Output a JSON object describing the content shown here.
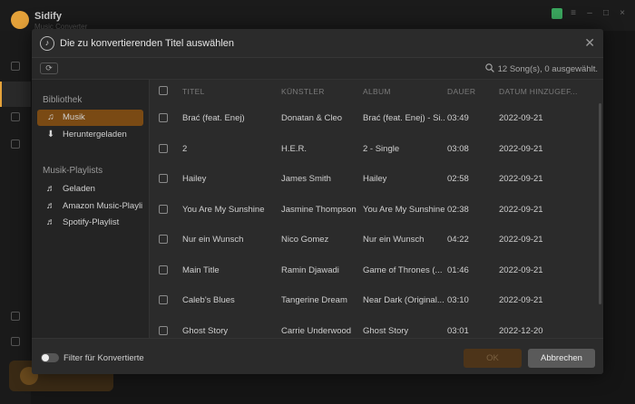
{
  "app": {
    "name": "Sidify",
    "subname": "Music Converter"
  },
  "dialog": {
    "title": "Die zu konvertierenden Titel auswählen",
    "close_icon": "close-icon",
    "song_count": "12 Song(s), 0 ausgewählt.",
    "sidebar": {
      "library_heading": "Bibliothek",
      "library_items": [
        {
          "label": "Musik",
          "icon": "music-note-icon",
          "active": true
        },
        {
          "label": "Heruntergeladen",
          "icon": "download-icon",
          "active": false
        }
      ],
      "playlists_heading": "Musik-Playlists",
      "playlist_items": [
        {
          "label": "Geladen",
          "icon": "playlist-icon"
        },
        {
          "label": "Amazon Music-Playli...",
          "icon": "playlist-icon"
        },
        {
          "label": "Spotify-Playlist",
          "icon": "playlist-icon"
        }
      ]
    },
    "table": {
      "headers": {
        "title": "TITEL",
        "artist": "KÜNSTLER",
        "album": "ALBUM",
        "duration": "DAUER",
        "date": "DATUM HINZUGEF..."
      },
      "rows": [
        {
          "title": "Brać (feat. Enej)",
          "artist": "Donatan & Cleo",
          "album": "Brać (feat. Enej) - Si...",
          "duration": "03:49",
          "date": "2022-09-21"
        },
        {
          "title": "2",
          "artist": "H.E.R.",
          "album": "2 - Single",
          "duration": "03:08",
          "date": "2022-09-21"
        },
        {
          "title": "Hailey",
          "artist": "James Smith",
          "album": "Hailey",
          "duration": "02:58",
          "date": "2022-09-21"
        },
        {
          "title": "You Are My Sunshine",
          "artist": "Jasmine Thompson",
          "album": "You Are My Sunshine",
          "duration": "02:38",
          "date": "2022-09-21"
        },
        {
          "title": "Nur ein Wunsch",
          "artist": "Nico Gomez",
          "album": "Nur ein Wunsch",
          "duration": "04:22",
          "date": "2022-09-21"
        },
        {
          "title": "Main Title",
          "artist": "Ramin Djawadi",
          "album": "Game of Thrones (...",
          "duration": "01:46",
          "date": "2022-09-21"
        },
        {
          "title": "Caleb's Blues",
          "artist": "Tangerine Dream",
          "album": "Near Dark (Original...",
          "duration": "03:10",
          "date": "2022-09-21"
        },
        {
          "title": "Ghost Story",
          "artist": "Carrie Underwood",
          "album": "Ghost Story",
          "duration": "03:01",
          "date": "2022-12-20"
        }
      ]
    },
    "footer": {
      "filter_label": "Filter für Konvertierte",
      "ok_label": "OK",
      "cancel_label": "Abbrechen"
    }
  },
  "colors": {
    "accent": "#7a4a14",
    "ok_disabled": "#4d3419"
  }
}
